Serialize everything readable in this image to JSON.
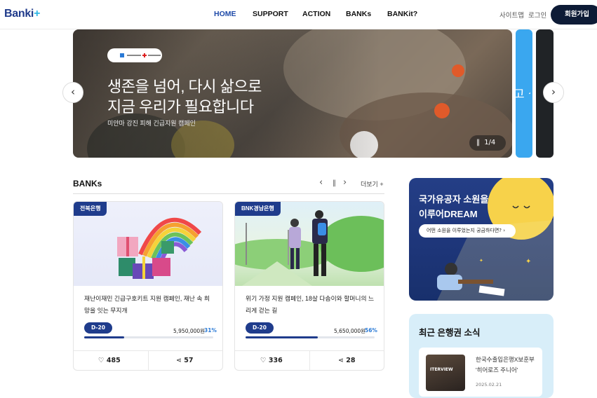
{
  "header": {
    "logo_text": "Banki",
    "logo_plus": "+",
    "nav": [
      {
        "label": "HOME",
        "active": true
      },
      {
        "label": "SUPPORT",
        "active": false
      },
      {
        "label": "ACTION",
        "active": false
      },
      {
        "label": "BANKs",
        "active": false
      },
      {
        "label": "BANKit?",
        "active": false
      }
    ],
    "sitemap_label": "사이트맵",
    "login_label": "로그인",
    "signup_label": "회원가입"
  },
  "hero": {
    "title_line1": "생존을 넘어, 다시 삶으로",
    "title_line2": "지금 우리가 필요합니다",
    "subtitle": "미얀마 강진 피해 긴급지원 캠페인",
    "counter": "1/4",
    "next_peek_text": "고 싶",
    "prev_icon": "chevron-left-icon",
    "next_icon": "chevron-right-icon",
    "pause_icon": "pause-icon"
  },
  "banks_section": {
    "title": "BANKs",
    "more_label": "더보기",
    "cards": [
      {
        "bank": "전북은행",
        "title": "재난이재민 긴급구호키트 지원 캠페인, 재난 속 희망을 잇는 무지개",
        "dday": "D-20",
        "amount": "5,950,000원",
        "percent": "31%",
        "progress": 0.31,
        "likes": "485",
        "shares": "57"
      },
      {
        "bank": "BNK경남은행",
        "title": "위기 가정 지원 캠페인, 18살 다솜이와 할머니의 느리게 걷는 길",
        "dday": "D-20",
        "amount": "5,650,000원",
        "percent": "56%",
        "progress": 0.56,
        "likes": "336",
        "shares": "28"
      }
    ]
  },
  "promo": {
    "title_line1": "국가유공자 소원을",
    "title_line2": "이루어DREAM",
    "button_label": "어떤 소원을 이루었는지 궁금하다면? ›"
  },
  "news": {
    "title": "최근 은행권 소식",
    "item_title": "한국수출입은행X보훈부 '히어로즈 주니어'",
    "item_date": "2025.02.21",
    "thumb_label": "ITERVIEW"
  },
  "colors": {
    "brand_navy": "#1f3c8c",
    "accent_blue": "#2a7ad6",
    "signup_bg": "#0d1b36"
  }
}
